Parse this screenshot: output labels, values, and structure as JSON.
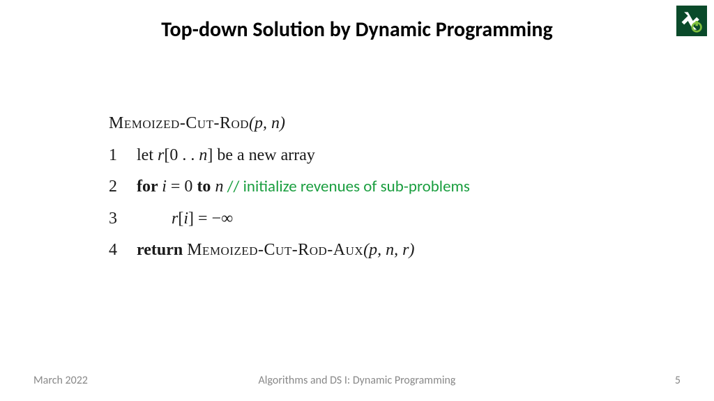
{
  "title": "Top-down Solution by Dynamic Programming",
  "pseudocode": {
    "func_header": "Memoized-Cut-Rod",
    "func_args": "(p, n)",
    "lines": {
      "l1_num": "1",
      "l1_let": "let ",
      "l1_r": "r",
      "l1_brack": "[0 . . ",
      "l1_n": "n",
      "l1_rest": "] be a new array",
      "l2_num": "2",
      "l2_for": "for ",
      "l2_i": "i",
      "l2_eq": "  =  0 ",
      "l2_to": "to ",
      "l2_n": "n",
      "l2_comment": "  // initialize revenues of sub-problems",
      "l3_num": "3",
      "l3_r": "r",
      "l3_brack": "[",
      "l3_i": "i",
      "l3_rest": "]  =  −∞",
      "l4_num": "4",
      "l4_ret": "return ",
      "l4_func": "Memoized-Cut-Rod-Aux",
      "l4_args": "(p, n, r)"
    }
  },
  "footer": {
    "date": "March 2022",
    "course": "Algorithms and DS I: Dynamic Programming",
    "page": "5"
  }
}
